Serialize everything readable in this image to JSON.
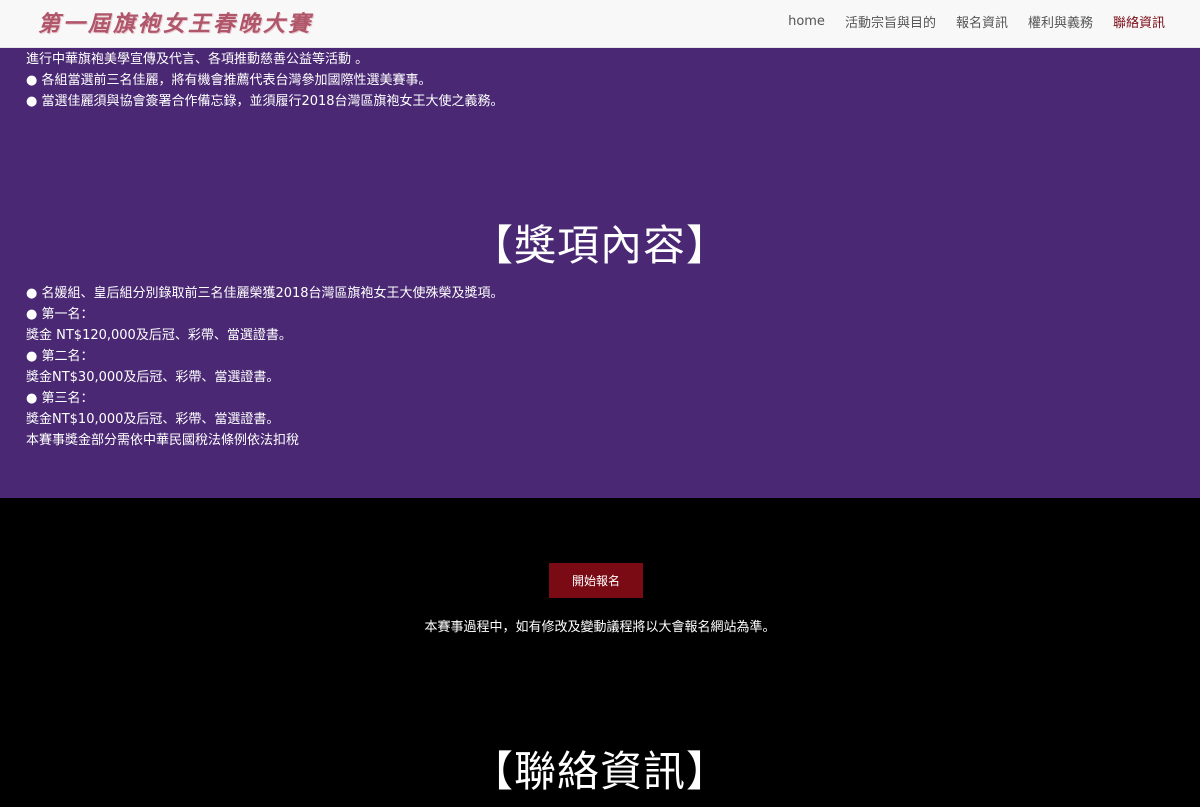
{
  "header": {
    "logo_text": "第一屆旗袍女王春晚大賽",
    "nav": [
      {
        "label": "home"
      },
      {
        "label": "活動宗旨與目的"
      },
      {
        "label": "報名資訊"
      },
      {
        "label": "權利與義務"
      },
      {
        "label": "聯絡資訊"
      }
    ]
  },
  "duties_section": {
    "lines": [
      "進行中華旗袍美學宣傳及代言、各項推動慈善公益等活動 。",
      "● 各組當選前三名佳麗，將有機會推薦代表台灣參加國際性選美賽事。",
      "● 當選佳麗須與協會簽署合作備忘錄，並須履行2018台灣區旗袍女王大使之義務。"
    ]
  },
  "awards_section": {
    "title": "【獎項內容】",
    "lines": [
      "● 名媛組、皇后組分別錄取前三名佳麗榮獲2018台灣區旗袍女王大使殊榮及獎項。",
      "● 第一名：",
      "獎金 NT$120,000及后冠、彩帶、當選證書。",
      "● 第二名：",
      "獎金NT$30,000及后冠、彩帶、當選證書。",
      "● 第三名：",
      "獎金NT$10,000及后冠、彩帶、當選證書。",
      "本賽事獎金部分需依中華民國稅法條例依法扣稅"
    ]
  },
  "signup": {
    "button_label": "開始報名",
    "notice": "本賽事過程中，如有修改及變動議程將以大會報名網站為準。"
  },
  "contact_section": {
    "title": "【聯絡資訊】"
  }
}
